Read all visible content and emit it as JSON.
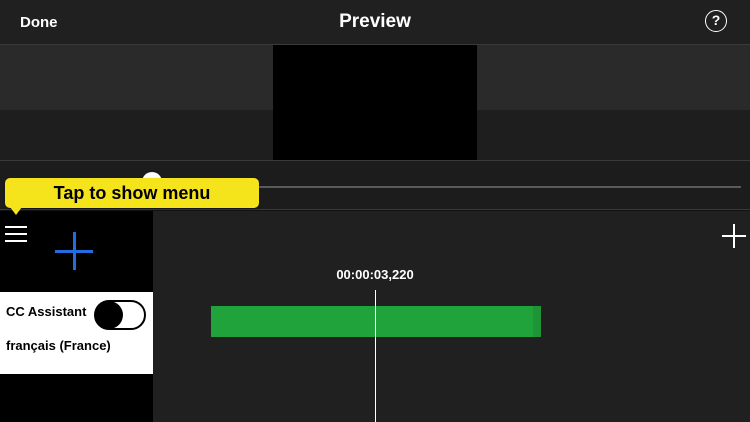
{
  "header": {
    "done_label": "Done",
    "title": "Preview",
    "help_label": "?"
  },
  "tooltip": {
    "text": "Tap to show menu"
  },
  "timeline": {
    "timecode": "00:00:03,220"
  },
  "cc_panel": {
    "title": "CC Assistant",
    "language": "français (France)",
    "toggle_on": false
  },
  "icons": {
    "menu": "hamburger-menu-icon",
    "add_primary": "plus-icon",
    "add_secondary": "plus-icon",
    "help": "question-circle-icon"
  },
  "colors": {
    "accent_blue": "#1f6fe0",
    "clip_green": "#21a33c",
    "tooltip_yellow": "#f5e41c"
  }
}
